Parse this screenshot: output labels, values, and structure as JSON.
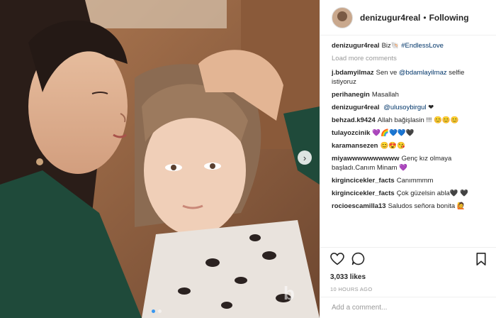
{
  "post": {
    "username": "denizugur4real",
    "separator": "•",
    "follow_state": "Following"
  },
  "caption": {
    "username": "denizugur4real",
    "text": "Biz🐚",
    "hashtag": "#EndlessLove"
  },
  "load_more": "Load more comments",
  "comments": [
    {
      "user": "j.bdamyilmaz",
      "pre": "Sen ve",
      "mention": "@bdamlayilmaz",
      "post": "selfie istiyoruz"
    },
    {
      "user": "perihanegin",
      "pre": "Masallah",
      "mention": "",
      "post": ""
    },
    {
      "user": "denizugur4real",
      "pre": "",
      "mention": "@ulusoybirgul",
      "post": "❤"
    },
    {
      "user": "behzad.k9424",
      "pre": "Allah bağişlasin !!! 😊😊😊",
      "mention": "",
      "post": ""
    },
    {
      "user": "tulayozcinik",
      "pre": "💜🌈💙💙🖤",
      "mention": "",
      "post": ""
    },
    {
      "user": "karamansezen",
      "pre": "😊😍😘",
      "mention": "",
      "post": ""
    },
    {
      "user": "miyawwwwwwwwww",
      "pre": "Genç kız olmaya başladı.Canım Minam 💜",
      "mention": "",
      "post": ""
    },
    {
      "user": "kirgincicekler_facts",
      "pre": "Canımmmm",
      "mention": "",
      "post": ""
    },
    {
      "user": "kirgincicekler_facts",
      "pre": "Çok güzelsin abla🖤 🖤",
      "mention": "",
      "post": ""
    },
    {
      "user": "rocioescamilla13",
      "pre": "Saludos señora bonita 🙋",
      "mention": "",
      "post": ""
    }
  ],
  "likes": "3,033 likes",
  "time": "10 HOURS AGO",
  "add_comment_placeholder": "Add a comment...",
  "watermark": "b",
  "carousel": {
    "count": 2,
    "active": 1
  },
  "icons": [
    "heart-icon",
    "comment-icon",
    "bookmark-icon",
    "next-arrow-icon"
  ],
  "colors": {
    "link": "#003569",
    "muted": "#999999",
    "border": "#efefef",
    "active_dot": "#3897f0"
  }
}
